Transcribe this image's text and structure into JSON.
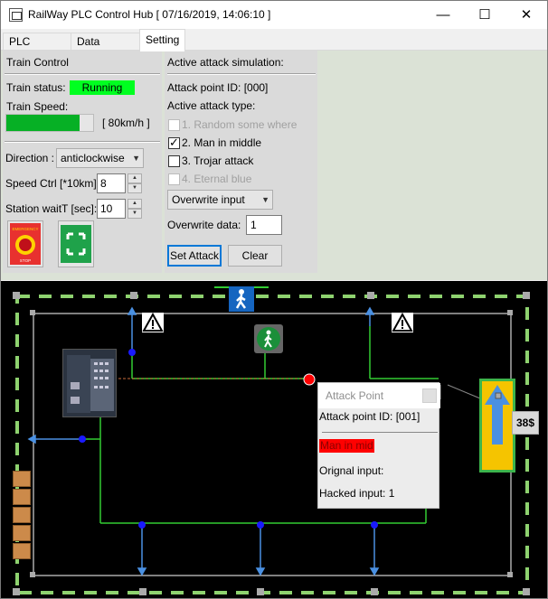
{
  "window": {
    "title": "RailWay PLC Control Hub [ 07/16/2019, 14:06:10 ]",
    "min_glyph": "—",
    "max_glyph": "☐",
    "close_glyph": "✕"
  },
  "tabs": [
    {
      "label": "PLC control"
    },
    {
      "label": "Data Display"
    },
    {
      "label": "Setting"
    }
  ],
  "train_control": {
    "title": "Train Control",
    "status_label": "Train status:",
    "status_value": "Running",
    "status_color": "#00ff20",
    "speed_label": "Train Speed:",
    "speed_fraction": 0.84,
    "speed_value": "[ 80km/h ]",
    "direction_label": "Direction :",
    "direction_value": "anticlockwise",
    "speed_ctrl_label": "Speed Ctrl [*10km]",
    "speed_ctrl_value": "8",
    "station_wait_label": "Station waitT [sec]:",
    "station_wait_value": "10",
    "emergency_button_icon": "emergency-stop-icon",
    "emergency_text_top": "EMERGENCY",
    "emergency_text_bottom": "STOP",
    "start_button_icon": "start-frame-icon"
  },
  "attack_sim": {
    "title": "Active attack simulation:",
    "point_id_label": "Attack point ID: [000]",
    "type_label": "Active attack type:",
    "options": [
      {
        "label": "1. Random some where",
        "checked": false,
        "disabled": true
      },
      {
        "label": "2. Man in middle",
        "checked": true,
        "disabled": false
      },
      {
        "label": "3. Trojar attack",
        "checked": false,
        "disabled": false
      },
      {
        "label": "4. Eternal blue",
        "checked": false,
        "disabled": true
      }
    ],
    "mode_value": "Overwrite input",
    "overwrite_label": "Overwrite data:",
    "overwrite_value": "1",
    "set_button": "Set Attack",
    "clear_button": "Clear"
  },
  "map": {
    "popup": {
      "title": "Attack Point",
      "point_id": "Attack point ID: [001]",
      "attack_type": "Man in mid",
      "original_input": "Orignal input:",
      "hacked_input": "Hacked input: 1"
    },
    "door_value": "38$",
    "colors": {
      "track": "#8ed26f",
      "wire": "#33cc33",
      "node": "#1a1aff",
      "attack_point": "#ff0000",
      "door": "#f5c400",
      "arrow": "#4a90e2"
    }
  }
}
